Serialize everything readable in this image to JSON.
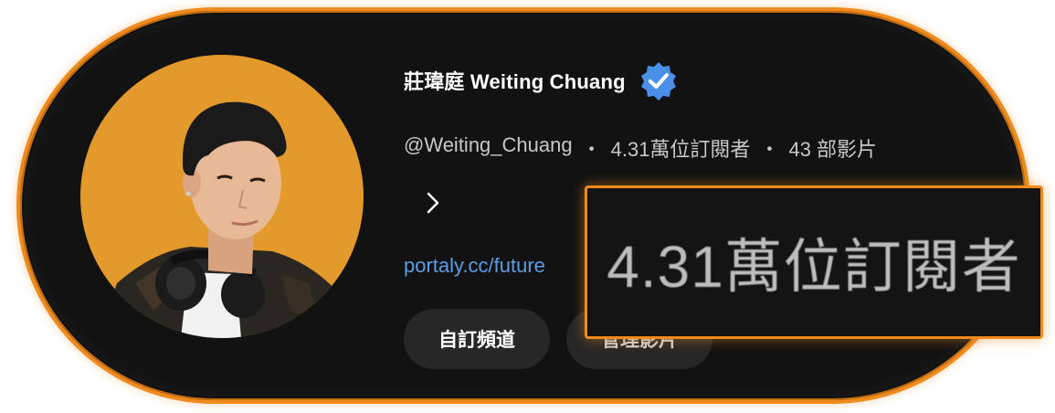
{
  "channel": {
    "name": "莊瑋庭 Weiting Chuang",
    "verified_icon": "verified-badge-icon",
    "handle": "@Weiting_Chuang",
    "separator": "・",
    "subscribers": "4.31萬位訂閱者",
    "videos": "43 部影片",
    "expand_icon": "chevron-right-icon",
    "link_text": "portaly.cc/future"
  },
  "buttons": {
    "customize_label": "自訂頻道",
    "manage_label": "管理影片"
  },
  "callout": {
    "text": "4.31萬位訂閱者"
  },
  "colors": {
    "accent": "#f08a1c",
    "background": "#121212",
    "link": "#5a9de6",
    "verified": "#4a8fe7",
    "avatar_bg": "#e49a2a"
  }
}
